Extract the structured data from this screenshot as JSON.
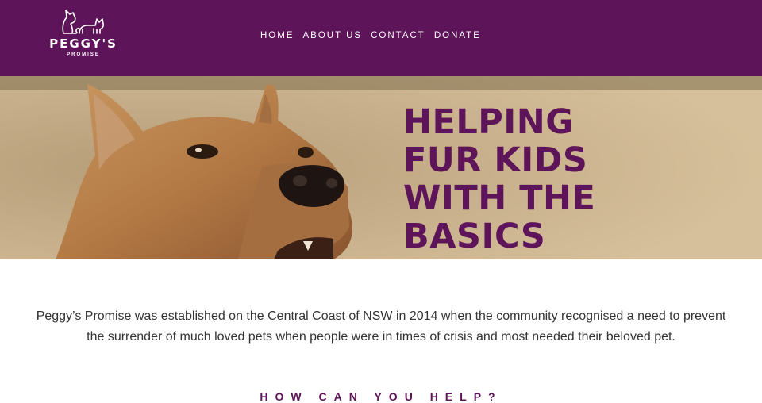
{
  "logo": {
    "name": "PEGGY'S",
    "sub": "PROMISE"
  },
  "nav": {
    "items": [
      "HOME",
      "ABOUT US",
      "CONTACT",
      "DONATE"
    ]
  },
  "hero": {
    "title_lines": [
      "HELPING",
      "FUR KIDS",
      "WITH THE",
      "BASICS"
    ]
  },
  "intro": {
    "text": "Peggy’s Promise was established on the Central Coast of NSW in 2014 when the community recognised a need to prevent the surrender of much loved pets when people were in times of crisis and most needed their beloved pet."
  },
  "help": {
    "heading": "HOW CAN YOU HELP?"
  },
  "colors": {
    "brand": "#5e1458",
    "text": "#333333"
  }
}
